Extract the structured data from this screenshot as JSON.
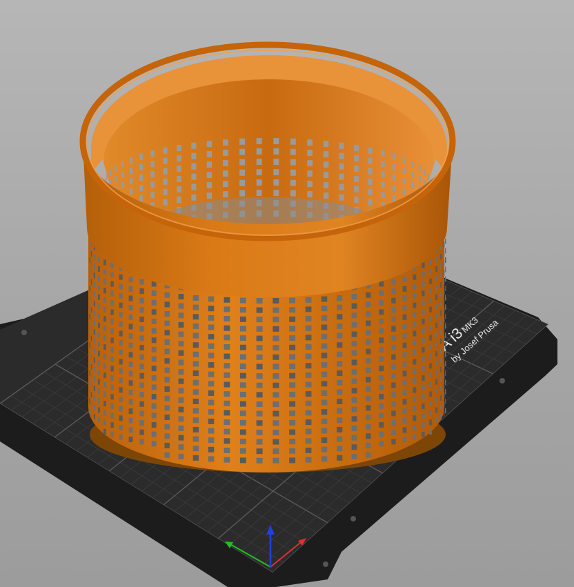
{
  "viewport": {
    "background_top": "#b6b6b6",
    "background_bottom": "#9c9c9c"
  },
  "bed": {
    "logo_line1": "USA i3",
    "logo_model": "MK3",
    "logo_line2": "by Josef Prusa",
    "plate_color": "#2a2a2a",
    "grid_color": "#3c3c3c",
    "grid_major_color": "#5a5a5a"
  },
  "model": {
    "object": "perforated-cylindrical-basket",
    "color_main": "#d4740f",
    "color_dark": "#a65505",
    "color_highlight": "#f09a3a",
    "color_inner": "#c56a10"
  },
  "axes": {
    "x_color": "#e03030",
    "y_color": "#20c020",
    "z_color": "#2040e0"
  }
}
